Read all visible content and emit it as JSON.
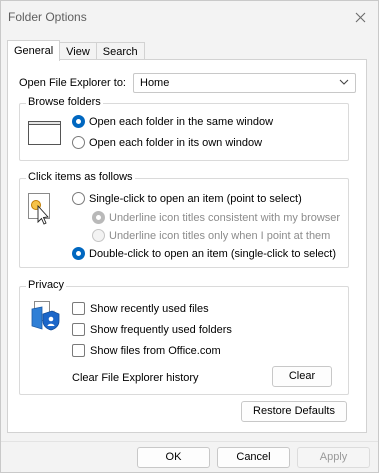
{
  "window": {
    "title": "Folder Options"
  },
  "tabs": [
    {
      "label": "General",
      "active": true
    },
    {
      "label": "View",
      "active": false
    },
    {
      "label": "Search",
      "active": false
    }
  ],
  "open_explorer": {
    "label": "Open File Explorer to:",
    "value": "Home"
  },
  "browse": {
    "title": "Browse folders",
    "options": [
      {
        "label": "Open each folder in the same window",
        "checked": true
      },
      {
        "label": "Open each folder in its own window",
        "checked": false
      }
    ]
  },
  "click": {
    "title": "Click items as follows",
    "options": [
      {
        "label": "Single-click to open an item (point to select)",
        "checked": false
      },
      {
        "label": "Underline icon titles consistent with my browser",
        "checked": true,
        "disabled": true
      },
      {
        "label": "Underline icon titles only when I point at them",
        "checked": false,
        "disabled": true
      },
      {
        "label": "Double-click to open an item (single-click to select)",
        "checked": true
      }
    ]
  },
  "privacy": {
    "title": "Privacy",
    "checks": [
      {
        "label": "Show recently used files",
        "checked": false
      },
      {
        "label": "Show frequently used folders",
        "checked": false
      },
      {
        "label": "Show files from Office.com",
        "checked": false
      }
    ],
    "clear_label": "Clear File Explorer history",
    "clear_button": "Clear"
  },
  "restore_button": "Restore Defaults",
  "footer": {
    "ok": "OK",
    "cancel": "Cancel",
    "apply": "Apply"
  },
  "colors": {
    "accent": "#0067c0",
    "panel": "#ffffff",
    "window": "#f3f3f3"
  }
}
